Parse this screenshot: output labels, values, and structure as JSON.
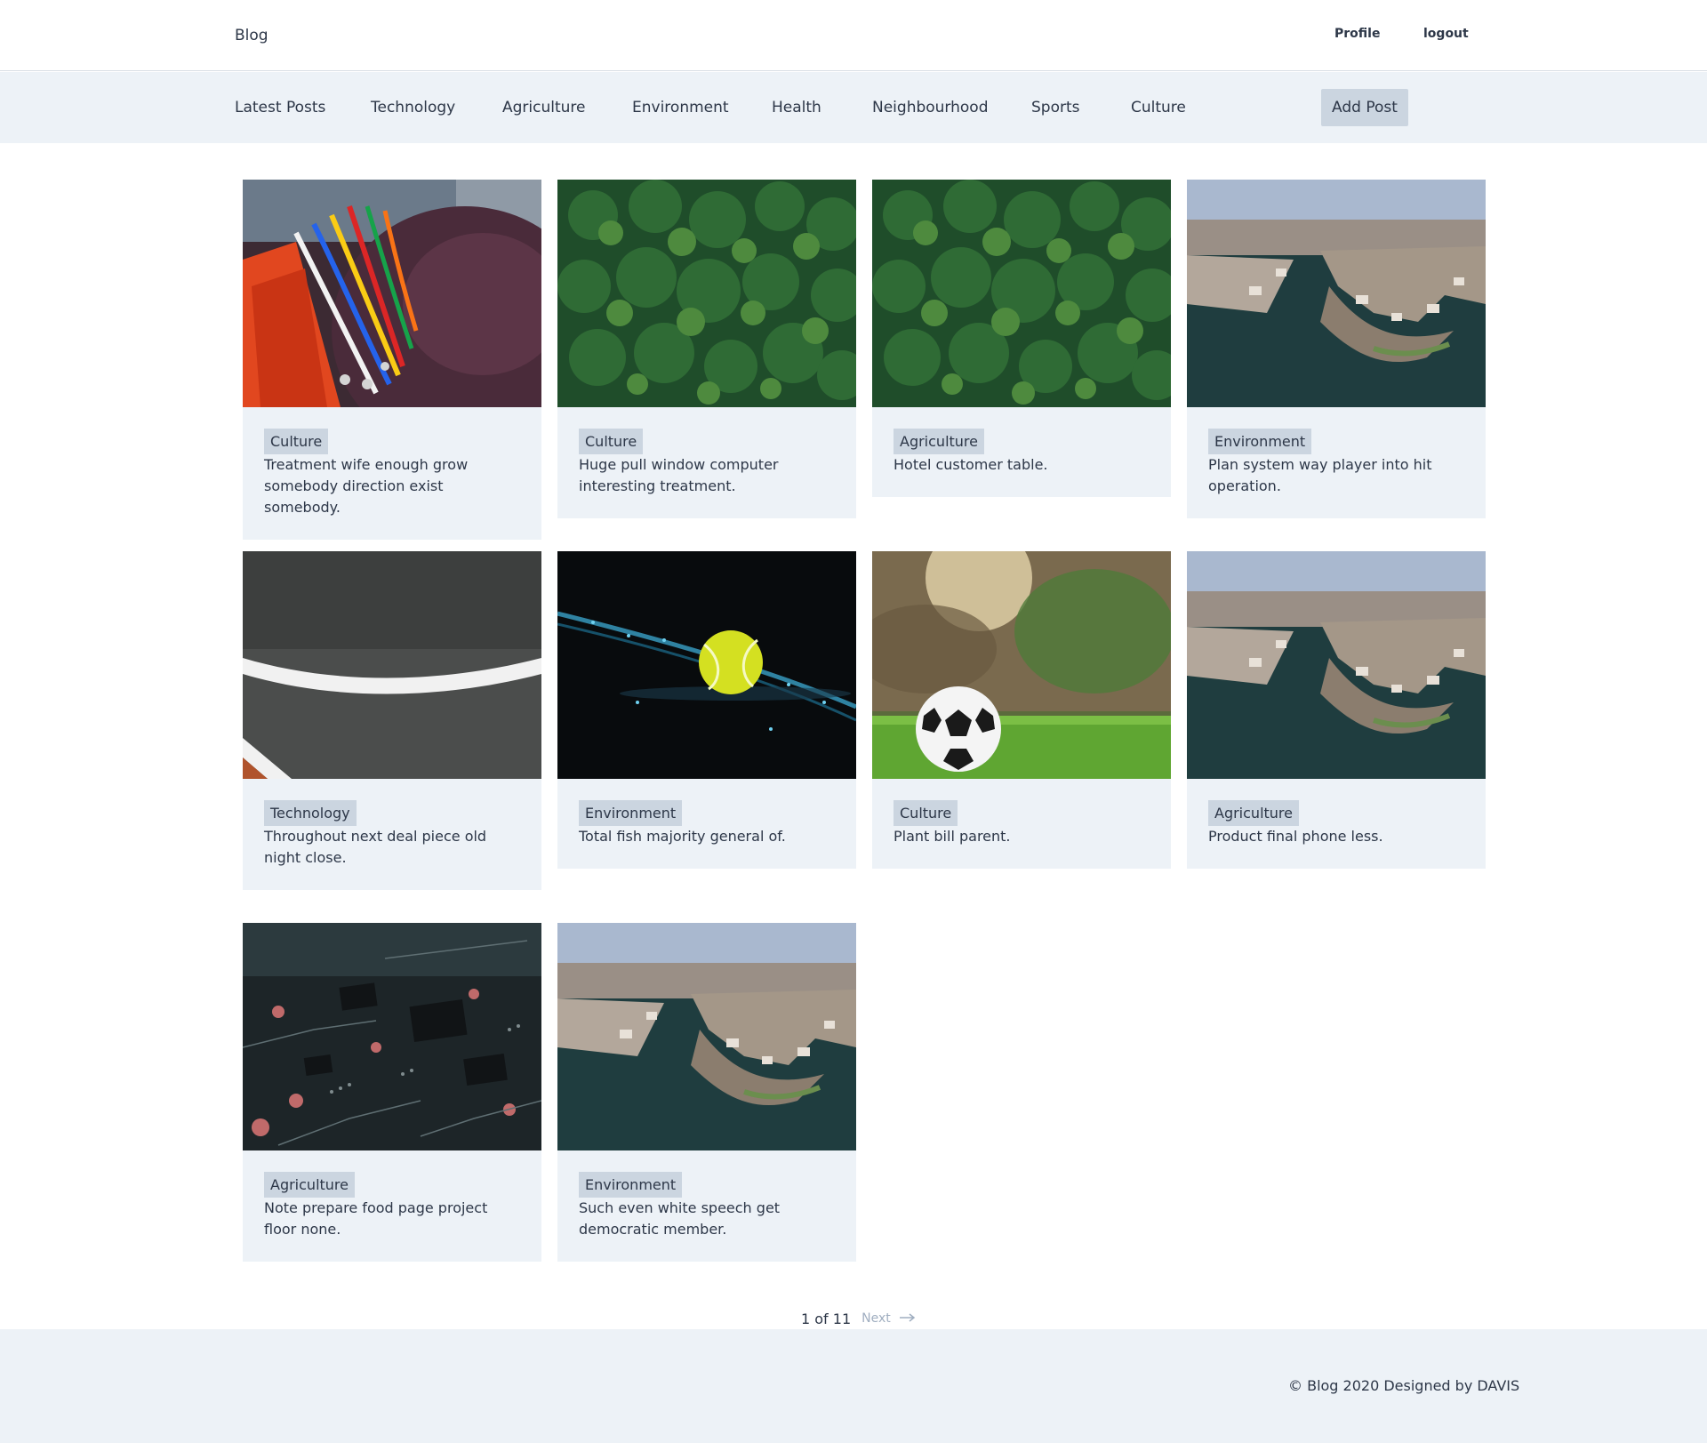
{
  "header": {
    "brand": "Blog",
    "profile_label": "Profile",
    "logout_label": "logout"
  },
  "nav": {
    "items": [
      {
        "label": "Latest Posts"
      },
      {
        "label": "Technology"
      },
      {
        "label": "Agriculture"
      },
      {
        "label": "Environment"
      },
      {
        "label": "Health"
      },
      {
        "label": "Neighbourhood"
      },
      {
        "label": "Sports"
      },
      {
        "label": "Culture"
      }
    ],
    "add_post_label": "Add Post"
  },
  "posts": [
    {
      "category": "Culture",
      "excerpt": "Treatment wife enough grow somebody direction exist somebody.",
      "image": "beaded-necklace-photo"
    },
    {
      "category": "Culture",
      "excerpt": "Huge pull window computer interesting treatment.",
      "image": "forest-aerial-photo"
    },
    {
      "category": "Agriculture",
      "excerpt": "Hotel customer table.",
      "image": "forest-aerial-photo"
    },
    {
      "category": "Environment",
      "excerpt": "Plan system way player into hit operation.",
      "image": "waterfront-town-aerial-photo"
    },
    {
      "category": "Technology",
      "excerpt": "Throughout next deal piece old night close.",
      "image": "court-lines-photo"
    },
    {
      "category": "Environment",
      "excerpt": "Total fish majority general of.",
      "image": "tennis-ball-photo"
    },
    {
      "category": "Culture",
      "excerpt": "Plant bill parent.",
      "image": "soccer-ball-photo"
    },
    {
      "category": "Agriculture",
      "excerpt": "Product final phone less.",
      "image": "waterfront-town-aerial-photo"
    },
    {
      "category": "Agriculture",
      "excerpt": "Note prepare food page project floor none.",
      "image": "circuit-board-photo"
    },
    {
      "category": "Environment",
      "excerpt": "Such even white speech get democratic member.",
      "image": "waterfront-town-aerial-photo"
    }
  ],
  "pagination": {
    "page_info": "1 of 11",
    "next_label": "Next"
  },
  "footer": {
    "copyright": "© Blog 2020 Designed by DAVIS"
  }
}
